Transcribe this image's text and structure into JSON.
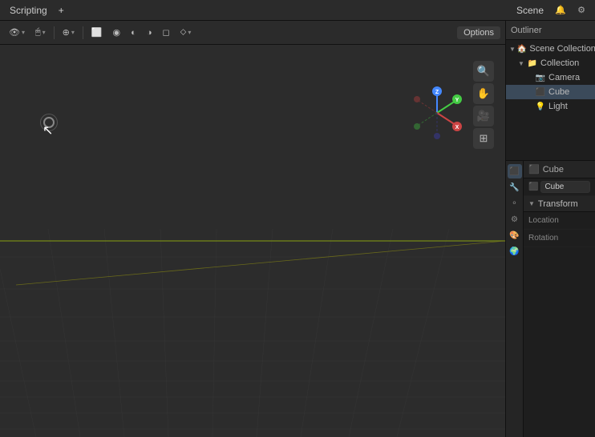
{
  "topbar": {
    "menus": [
      "Scripting"
    ],
    "plus_icon": "+",
    "scene_label": "Scene",
    "right_icons": [
      "🔔",
      "⚙"
    ]
  },
  "viewport": {
    "toolbar_left": [
      {
        "label": "👁",
        "has_arrow": true,
        "name": "select-mode"
      },
      {
        "label": "🖱",
        "has_arrow": true,
        "name": "viewport-shading"
      },
      {
        "label": "🌐",
        "has_arrow": true,
        "name": "pivot-point"
      },
      {
        "label": "🔲",
        "has_arrow": false,
        "name": "overlay"
      },
      {
        "label": "◉",
        "has_arrow": false,
        "name": "shading-solid"
      },
      {
        "label": "◐",
        "has_arrow": false,
        "name": "shading-material"
      },
      {
        "label": "◑",
        "has_arrow": false,
        "name": "shading-rendered"
      },
      {
        "label": "◻",
        "has_arrow": false,
        "name": "shading-eevee"
      },
      {
        "label": "⬦",
        "has_arrow": true,
        "name": "viewport-extra"
      }
    ],
    "options_label": "Options",
    "tools": [
      {
        "icon": "🔍",
        "name": "zoom-tool"
      },
      {
        "icon": "✋",
        "name": "pan-tool"
      },
      {
        "icon": "🎥",
        "name": "camera-tool"
      },
      {
        "icon": "⊞",
        "name": "grid-tool"
      }
    ]
  },
  "outliner": {
    "title": "Outliner",
    "items": [
      {
        "label": "Scene Collection",
        "icon": "scene",
        "indent": 0,
        "expanded": true
      },
      {
        "label": "Collection",
        "icon": "collection",
        "indent": 1,
        "expanded": true
      },
      {
        "label": "Camera",
        "icon": "camera",
        "indent": 2,
        "expanded": false
      },
      {
        "label": "Cube",
        "icon": "mesh",
        "indent": 2,
        "expanded": false,
        "selected": true
      },
      {
        "label": "Light",
        "icon": "light",
        "indent": 2,
        "expanded": false
      }
    ]
  },
  "properties": {
    "active_object_name": "Cube",
    "active_data_name": "Cube",
    "sections": [
      {
        "label": "Transform",
        "expanded": true,
        "fields": [
          {
            "label": "Location",
            "name": "location-field"
          },
          {
            "label": "Rotation",
            "name": "rotation-field"
          }
        ]
      }
    ],
    "sidebar_icons": [
      "🔧",
      "🎛",
      "📦",
      "🔗",
      "⚙",
      "🎨"
    ]
  }
}
